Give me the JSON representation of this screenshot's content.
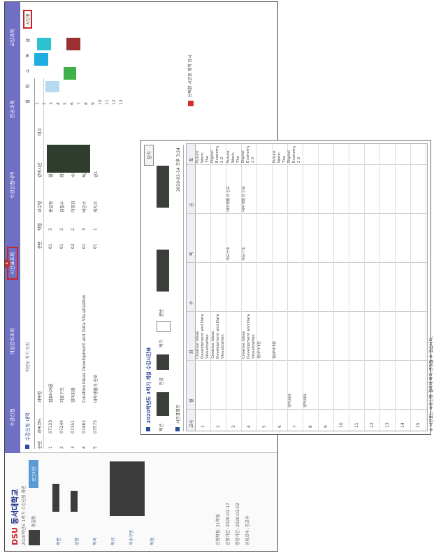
{
  "portal": {
    "logo_prefix": "DSU",
    "logo_main": "동서대학교",
    "subtitle": "2020학년도 1학기 수강신청 화면",
    "user_name": "홍길동",
    "login_button": "로그아웃",
    "side_rows": [
      "학번",
      "성명",
      "학과",
      "학년",
      "이수구분",
      "학점"
    ],
    "side_info": [
      "신청학점: 21학점",
      "신청기간: 2020-02-17",
      "정정기간: 2020-03-02",
      "상담교수: 김교수"
    ],
    "nav_items": [
      "수강신청",
      "개설강좌조회",
      "시간표조회",
      "수강신청내역",
      "전공과목",
      "교양과목"
    ],
    "nav_badge": "1",
    "main_title": "수강신청 내역",
    "main_tabs": "학년도  학기  조회",
    "header": [
      "순번",
      "과목코드",
      "과목명",
      "분반",
      "학점",
      "교수명",
      "강의시간",
      "비고"
    ],
    "rows": [
      [
        "1",
        "07123",
        "컴퓨터개론",
        "01",
        "3",
        "홍길동",
        "월1-2"
      ],
      [
        "2",
        "07244",
        "자료구조",
        "01",
        "3",
        "김철수",
        "화3-4"
      ],
      [
        "3",
        "07351",
        "영어회화",
        "02",
        "2",
        "이영희",
        "수5-6"
      ],
      [
        "4",
        "07462",
        "Creative Ideas Development and Data Visualization",
        "01",
        "3",
        "박민수",
        "목2-3"
      ],
      [
        "5",
        "07575",
        "대학생활과 진로",
        "01",
        "1",
        "최지우",
        "금1"
      ]
    ],
    "timetable": {
      "days": [
        "월",
        "화",
        "수",
        "목",
        "금",
        "토"
      ],
      "current": "시간표",
      "periods": [
        "1",
        "2",
        "3",
        "4",
        "5",
        "6",
        "7",
        "8",
        "9",
        "10",
        "11",
        "12",
        "13",
        "14",
        "15"
      ]
    },
    "legend": "선택한 시간표 영역 표시"
  },
  "popup": {
    "title": "2020학년도 1학기 개설 수강시간표",
    "close": "닫기",
    "selectors": [
      "학년",
      "전공",
      "학기",
      "분반"
    ],
    "note": "시간표확인",
    "date": "2020-02-14 오후 3:24",
    "columns": [
      "교시",
      "월",
      "화",
      "수",
      "목",
      "금",
      "토"
    ],
    "cells": [
      {
        "row": 0,
        "col": 1,
        "text": "Creative Ideas Development and Data Visualization"
      },
      {
        "row": 1,
        "col": 1,
        "text": "Creative Ideas Development and Data Visualization"
      },
      {
        "row": 3,
        "col": 1,
        "text": "Creative Ideas Development and Data Visualization"
      },
      {
        "row": 4,
        "col": 1,
        "text": "컴퓨터개론"
      },
      {
        "row": 5,
        "col": 1,
        "text": "컴퓨터개론"
      },
      {
        "row": 2,
        "col": 3,
        "text": "자료구조"
      },
      {
        "row": 3,
        "col": 3,
        "text": "자료구조"
      },
      {
        "row": 6,
        "col": 0,
        "text": "영어회화"
      },
      {
        "row": 7,
        "col": 0,
        "text": "영어회화"
      },
      {
        "row": 2,
        "col": 4,
        "text": "대학생활과 진로"
      },
      {
        "row": 3,
        "col": 4,
        "text": "대학생활과 진로"
      },
      {
        "row": 0,
        "col": 5,
        "text": "Future Work: The Digital Economy 2.0"
      },
      {
        "row": 2,
        "col": 5,
        "text": "Future Work: The Digital Economy 2.0"
      },
      {
        "row": 5,
        "col": 5,
        "text": "Future Work: The Digital Economy 2.0"
      }
    ],
    "period_count": 15,
    "footer": "※ 시간표는 수강신청 결과에 따라 변경될 수 있습니다."
  }
}
